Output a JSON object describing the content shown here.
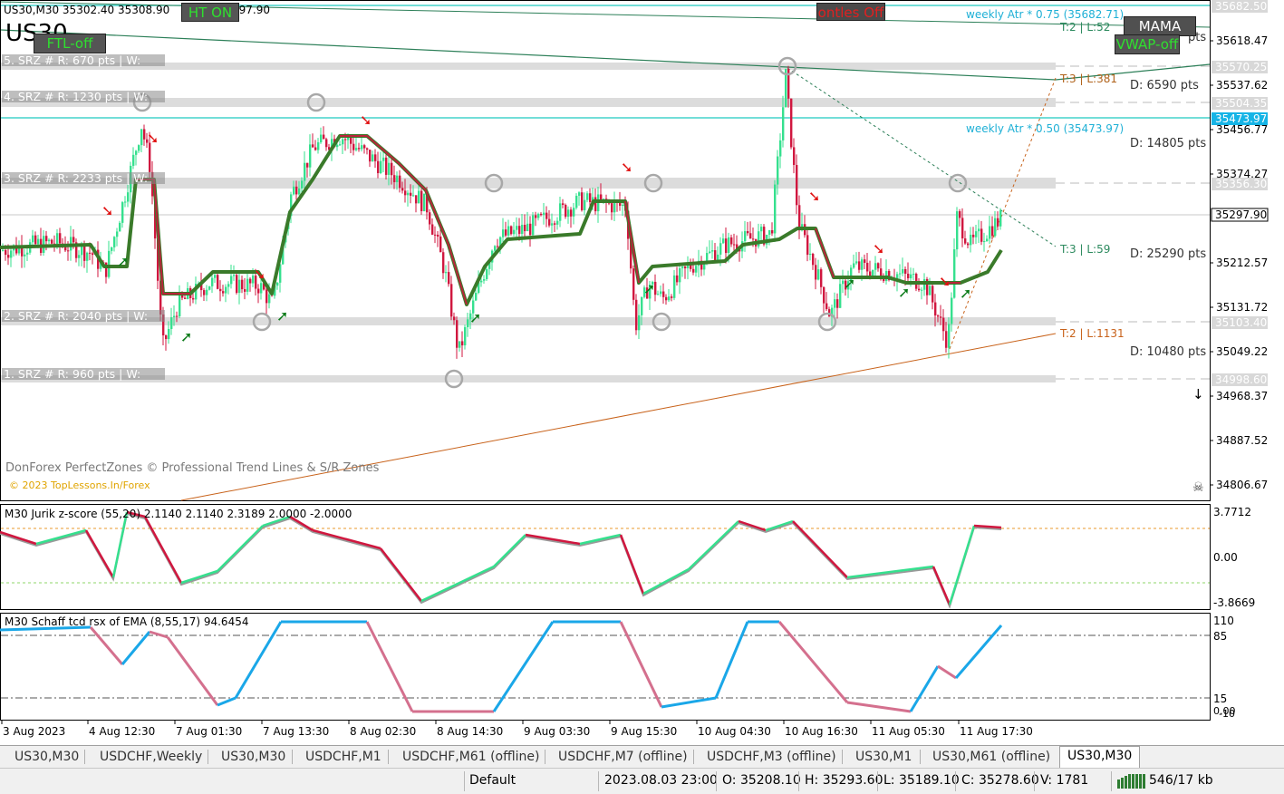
{
  "window": {
    "info_line": "US30,M30  35302.40 35308.90",
    "symbol_big": "US30",
    "info_tail": "297.90"
  },
  "buttons": {
    "ht": "HT ON",
    "ftl": "FTL-off",
    "fractals": "ontles Off",
    "mama": "MAMA",
    "vwap": "VWAP-off"
  },
  "zones": [
    {
      "label": "5. SRZ # R: 670 pts  |  W:",
      "price": "35570.25"
    },
    {
      "label": "4. SRZ # R: 1230 pts  |  W:",
      "price": "35504.35"
    },
    {
      "label": "3. SRZ # R: 2233 pts  |  W:",
      "price": "35356.30"
    },
    {
      "label": "2. SRZ # R: 2040 pts  |  W:",
      "price": "35103.40"
    },
    {
      "label": "1. SRZ # R: 960 pts  |  W:",
      "price": "34998.60"
    }
  ],
  "right_annotations": {
    "atr75": "weekly Atr * 0.75 (35682.71)",
    "atr50": "weekly Atr * 0.50 (35473.97)",
    "t2_top": "T:2  |  L:52",
    "t3_top": "T:3  |  L:381",
    "t3_mid": "T:3  |  L:59",
    "t2_bot": "T:2  |  L:1131",
    "d_6590": "D: 6590 pts",
    "d_14805": "D: 14805 pts",
    "d_25290": "D: 25290 pts",
    "d_10480": "D: 10480 pts",
    "pts_clip": "pts"
  },
  "price_axis": {
    "ticks": [
      "35618.47",
      "35537.62",
      "35456.77",
      "35374.27",
      "35212.57",
      "35131.72",
      "35049.22",
      "34968.37",
      "34887.52",
      "34806.67"
    ],
    "boxes": {
      "atr75": "35682.50",
      "zone5": "35570.25",
      "zone4": "35504.35",
      "atr50": "35473.97",
      "zone3": "35356.30",
      "current": "35297.90",
      "zone2": "35103.40",
      "zone1": "34998.60"
    }
  },
  "watermark": {
    "line1": "DonForex PerfectZones © Professional Trend Lines & S/R Zones",
    "line2": "© 2023 TopLessons.In/Forex"
  },
  "indicator1": {
    "title": "M30 Jurik z-score (55,20) 2.1140 2.1140 2.3189 2.0000 -2.0000",
    "axis": [
      "3.7712",
      "0.00",
      "-3.8669"
    ]
  },
  "indicator2": {
    "title": "M30 Schaff tcd rsx of EMA (8,55,17) 94.6454",
    "axis": [
      "110",
      "85",
      "15",
      "0.00",
      "-10"
    ]
  },
  "time_axis": [
    "3 Aug 2023",
    "4 Aug 12:30",
    "7 Aug 01:30",
    "7 Aug 13:30",
    "8 Aug 02:30",
    "8 Aug 14:30",
    "9 Aug 03:30",
    "9 Aug 15:30",
    "10 Aug 04:30",
    "10 Aug 16:30",
    "11 Aug 05:30",
    "11 Aug 17:30"
  ],
  "tabs": [
    "US30,M30",
    "USDCHF,Weekly",
    "US30,M30",
    "USDCHF,M1",
    "USDCHF,M61 (offline)",
    "USDCHF,M7 (offline)",
    "USDCHF,M3 (offline)",
    "US30,M1",
    "US30,M61 (offline)",
    "US30,M30"
  ],
  "status": {
    "profile": "Default",
    "datetime": "2023.08.03 23:00",
    "open": "O: 35208.10",
    "high": "H: 35293.60",
    "low": "L: 35189.10",
    "close": "C: 35278.60",
    "volume": "V: 1781",
    "traffic": "546/17 kb"
  },
  "colors": {
    "bull": "#35e08e",
    "bear": "#d0173f",
    "trend_line": "#3a7a2a",
    "zone_fill": "#d8d8d8",
    "atr_line": "#1ec9c0",
    "schaff_up": "#1aa7e8",
    "schaff_down": "#d4708e"
  },
  "chart_data": {
    "type": "candlestick",
    "symbol": "US30",
    "timeframe": "M30",
    "close_path": [
      [
        "3 Aug 2023",
        35240
      ],
      [
        "4 Aug 12:30",
        35420
      ],
      [
        "4 Aug 18:00",
        35060
      ],
      [
        "7 Aug 01:30",
        35150
      ],
      [
        "7 Aug 13:30",
        35450
      ],
      [
        "8 Aug 02:30",
        35420
      ],
      [
        "8 Aug 14:30",
        35090
      ],
      [
        "9 Aug 03:30",
        35300
      ],
      [
        "9 Aug 15:30",
        35110
      ],
      [
        "10 Aug 04:30",
        35280
      ],
      [
        "10 Aug 12:00",
        35550
      ],
      [
        "10 Aug 16:30",
        35300
      ],
      [
        "11 Aug 05:30",
        35190
      ],
      [
        "11 Aug 12:00",
        35060
      ],
      [
        "11 Aug 17:30",
        35300
      ]
    ],
    "current_price": 35297.9,
    "ylim": [
      34780,
      35700
    ]
  }
}
